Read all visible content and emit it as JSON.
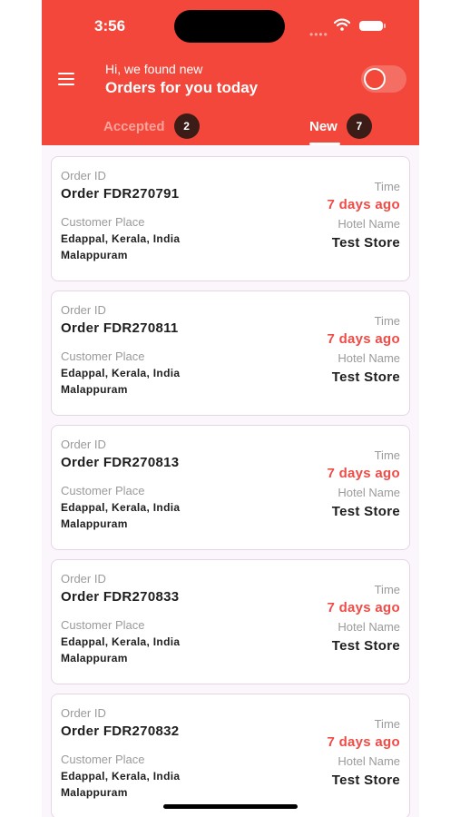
{
  "status_bar": {
    "time": "3:56"
  },
  "header": {
    "greeting": "Hi, we found new",
    "headline": "Orders for you today",
    "toggle_on": false,
    "accent_color": "#f2473a"
  },
  "tabs": [
    {
      "label": "Accepted",
      "count": "2",
      "selected": false
    },
    {
      "label": "New",
      "count": "7",
      "selected": true
    }
  ],
  "labels": {
    "order_id": "Order ID",
    "customer_place": "Customer Place",
    "time": "Time",
    "hotel_name": "Hotel Name"
  },
  "orders": [
    {
      "order": "Order FDR270791",
      "place_line1": "Edappal, Kerala, India",
      "place_line2": "Malappuram",
      "time": "7 days ago",
      "hotel": "Test Store"
    },
    {
      "order": "Order FDR270811",
      "place_line1": "Edappal, Kerala, India",
      "place_line2": "Malappuram",
      "time": "7 days ago",
      "hotel": "Test Store"
    },
    {
      "order": "Order FDR270813",
      "place_line1": "Edappal, Kerala, India",
      "place_line2": "Malappuram",
      "time": "7 days ago",
      "hotel": "Test Store"
    },
    {
      "order": "Order FDR270833",
      "place_line1": "Edappal, Kerala, India",
      "place_line2": "Malappuram",
      "time": "7 days ago",
      "hotel": "Test Store"
    },
    {
      "order": "Order FDR270832",
      "place_line1": "Edappal, Kerala, India",
      "place_line2": "Malappuram",
      "time": "7 days ago",
      "hotel": "Test Store"
    }
  ],
  "icons": {
    "menu": "hamburger-menu-icon",
    "wifi": "wifi-icon",
    "battery": "battery-icon"
  }
}
